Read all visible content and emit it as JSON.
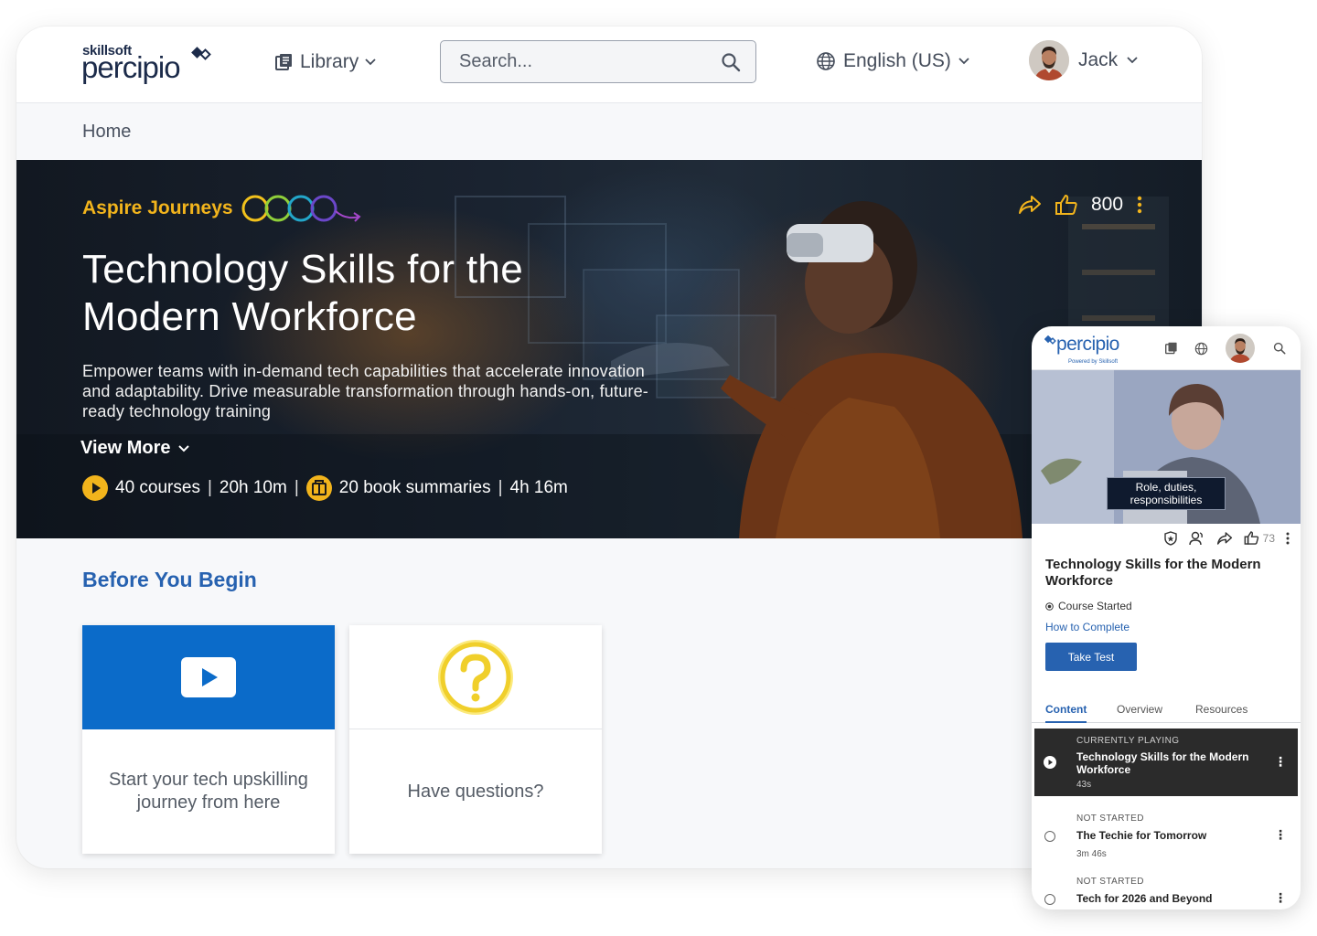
{
  "header": {
    "logo_small": "skillsoft",
    "logo_big": "percipio",
    "library_label": "Library",
    "search_placeholder": "Search...",
    "language_label": "English (US)",
    "user_name": "Jack"
  },
  "breadcrumb": "Home",
  "hero": {
    "eyebrow": "Aspire Journeys",
    "title": "Technology Skills for the Modern Workforce",
    "description": "Empower teams with in-demand tech capabilities that accelerate innovation and adaptability. Drive measurable transformation through hands-on, future-ready technology training",
    "view_more": "View More",
    "courses": "40 courses",
    "courses_duration": "20h 10m",
    "books": "20 book summaries",
    "books_duration": "4h 16m",
    "likes": "800"
  },
  "before_you_begin": {
    "title": "Before You Begin",
    "cards": [
      {
        "text": "Start your tech upskilling journey from here"
      },
      {
        "text": "Have questions?"
      }
    ]
  },
  "mobile": {
    "logo": "percipio",
    "logo_sub": "Powered by Skillsoft",
    "video_caption": "Role, duties, responsibilities",
    "likes": "73",
    "title": "Technology Skills for the Modern Workforce",
    "status": "Course Started",
    "how_to_complete": "How to Complete",
    "take_test": "Take Test",
    "tabs": [
      "Content",
      "Overview",
      "Resources"
    ],
    "playlist": [
      {
        "state": "CURRENTLY PLAYING",
        "title": "Technology Skills for the Modern Workforce",
        "duration": "43s"
      },
      {
        "state": "NOT STARTED",
        "title": "The Techie for Tomorrow",
        "duration": "3m 46s"
      },
      {
        "state": "NOT STARTED",
        "title": "Tech for 2026 and Beyond",
        "duration": ""
      }
    ]
  },
  "colors": {
    "brand_blue": "#2762b0",
    "accent_yellow": "#f2b41c",
    "card_blue": "#0b6bc9"
  }
}
